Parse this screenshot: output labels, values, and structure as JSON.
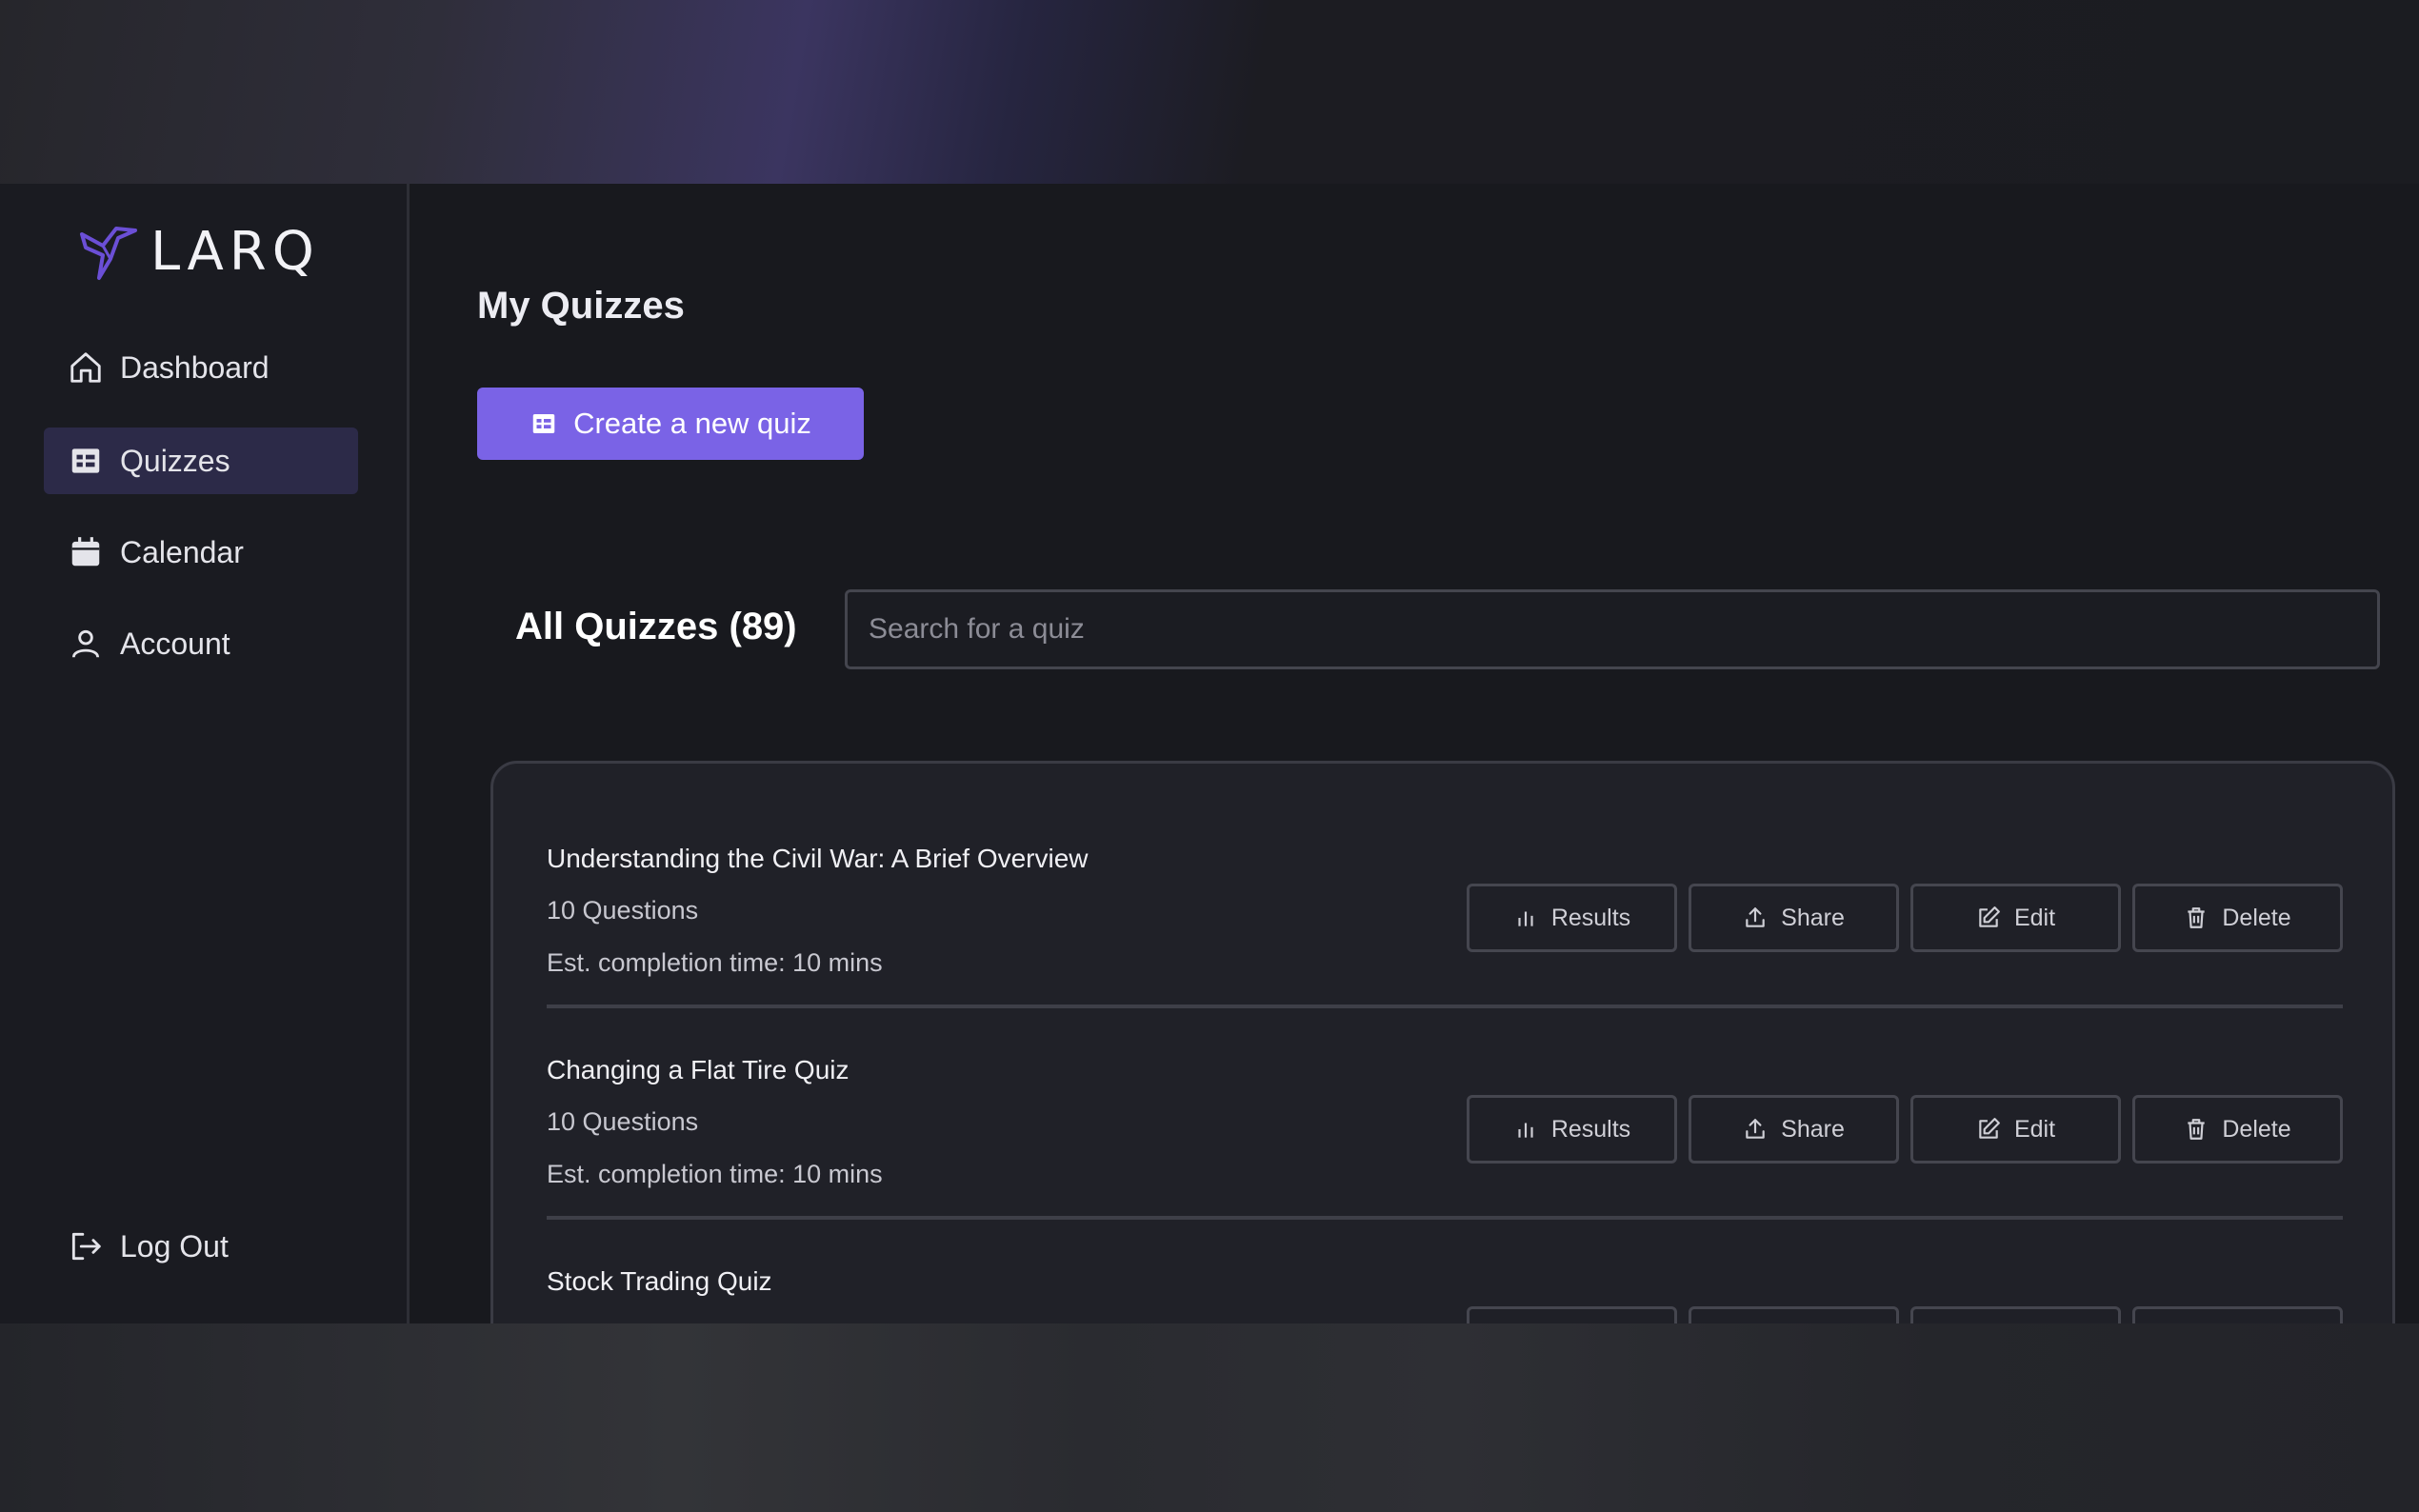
{
  "brand": {
    "name": "LARQ",
    "accent": "#7a63e6"
  },
  "sidebar": {
    "items": [
      {
        "label": "Dashboard",
        "icon": "home-icon"
      },
      {
        "label": "Quizzes",
        "icon": "quizzes-icon",
        "active": true
      },
      {
        "label": "Calendar",
        "icon": "calendar-icon"
      },
      {
        "label": "Account",
        "icon": "user-icon"
      }
    ],
    "logout": {
      "label": "Log Out",
      "icon": "logout-icon"
    }
  },
  "main": {
    "title": "My Quizzes",
    "create_button": "Create a new quiz",
    "all_heading": "All Quizzes (89)",
    "search_placeholder": "Search for a quiz"
  },
  "actions": {
    "results": "Results",
    "share": "Share",
    "edit": "Edit",
    "delete": "Delete"
  },
  "quizzes": [
    {
      "title": "Understanding the Civil War: A Brief Overview",
      "questions": "10 Questions",
      "time": "Est. completion time: 10 mins"
    },
    {
      "title": "Changing a Flat Tire Quiz",
      "questions": "10 Questions",
      "time": "Est. completion time: 10 mins"
    },
    {
      "title": "Stock Trading Quiz",
      "questions": "",
      "time": ""
    }
  ]
}
